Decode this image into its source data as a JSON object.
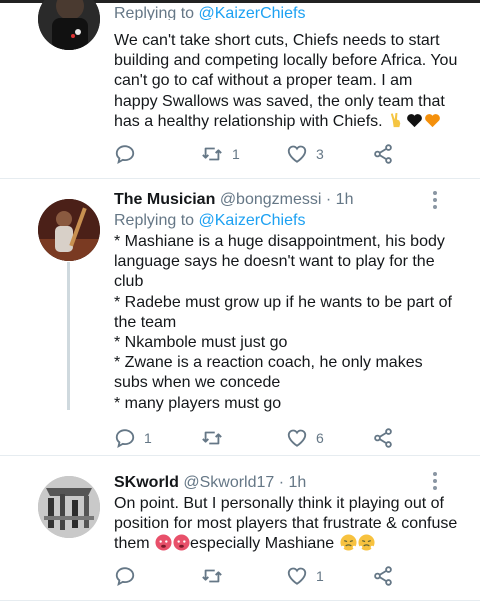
{
  "tweets": [
    {
      "reply_prefix": "Replying to",
      "reply_to": "@KaizerChiefs",
      "text": "We can't take short cuts, Chiefs needs to start building and competing locally before Africa. You can't go to caf without a proper team. I am happy Swallows was saved, the only team that has a healthy relationship with Chiefs.",
      "emojis": [
        "victory-hand-emoji",
        "black-heart-emoji",
        "orange-heart-emoji"
      ],
      "replies": "",
      "retweets": "1",
      "likes": "3"
    },
    {
      "name": "The Musician",
      "handle": "@bongzmessi",
      "separator": "·",
      "time": "1h",
      "reply_prefix": "Replying to",
      "reply_to": "@KaizerChiefs",
      "lines": [
        "* Mashiane is a huge disappointment, his body language says he doesn't want to play for the club",
        "* Radebe must grow up if he wants to be part of the team",
        "* Nkambole must just go",
        "* Zwane is a reaction coach, he only makes subs when we concede",
        "* many players must go"
      ],
      "replies": "1",
      "retweets": "",
      "likes": "6"
    },
    {
      "name": "SKworld",
      "handle": "@Skworld17",
      "separator": "·",
      "time": "1h",
      "text_main": "On point. But I personally think it playing out of position for most players that frustrate & confuse them",
      "text_tail": "especially Mashiane",
      "emojis": [
        "hot-face-emoji",
        "hot-face-emoji",
        "face-with-steam-emoji",
        "face-with-steam-emoji"
      ],
      "replies": "",
      "retweets": "",
      "likes": "1"
    }
  ],
  "colors": {
    "text": "#14171a",
    "secondary": "#657786",
    "link": "#1da1f2",
    "divider": "#e6ecf0"
  }
}
